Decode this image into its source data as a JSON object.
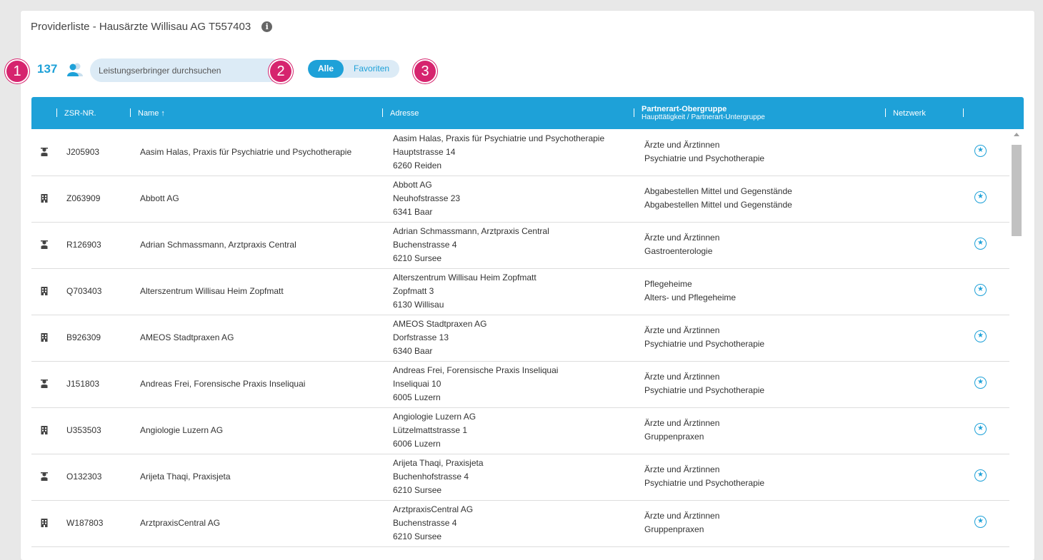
{
  "header": {
    "title": "Providerliste - Hausärzte Willisau AG T557403",
    "info_icon": "i"
  },
  "toolbar": {
    "count": "137",
    "search_placeholder": "Leistungserbringer durchsuchen",
    "filter_all": "Alle",
    "filter_favorites": "Favoriten",
    "active_filter": "Alle"
  },
  "markers": [
    "1",
    "2",
    "3"
  ],
  "table": {
    "headers": {
      "zsr": "ZSR-NR.",
      "name": "Name ↑",
      "address": "Adresse",
      "partner_main": "Partnerart-Obergruppe",
      "partner_sub": "Haupttätigkeit / Partnerart-Untergruppe",
      "network": "Netzwerk"
    },
    "rows": [
      {
        "type": "person",
        "zsr": "J205903",
        "name": "Aasim Halas, Praxis für Psychiatrie und Psychotherapie",
        "addr1": "Aasim Halas, Praxis für Psychiatrie und Psychotherapie",
        "addr2": "Hauptstrasse 14",
        "addr3": "6260 Reiden",
        "part1": "Ärzte und Ärztinnen",
        "part2": "Psychiatrie und Psychotherapie"
      },
      {
        "type": "building",
        "zsr": "Z063909",
        "name": "Abbott AG",
        "addr1": "Abbott AG",
        "addr2": "Neuhofstrasse 23",
        "addr3": "6341 Baar",
        "part1": "Abgabestellen Mittel und Gegenstände",
        "part2": "Abgabestellen Mittel und Gegenstände"
      },
      {
        "type": "person",
        "zsr": "R126903",
        "name": "Adrian Schmassmann, Arztpraxis Central",
        "addr1": "Adrian Schmassmann, Arztpraxis Central",
        "addr2": "Buchenstrasse 4",
        "addr3": "6210 Sursee",
        "part1": "Ärzte und Ärztinnen",
        "part2": "Gastroenterologie"
      },
      {
        "type": "building",
        "zsr": "Q703403",
        "name": "Alterszentrum Willisau Heim Zopfmatt",
        "addr1": "Alterszentrum Willisau Heim Zopfmatt",
        "addr2": "Zopfmatt 3",
        "addr3": "6130 Willisau",
        "part1": "Pflegeheime",
        "part2": "Alters- und Pflegeheime"
      },
      {
        "type": "building",
        "zsr": "B926309",
        "name": "AMEOS Stadtpraxen AG",
        "addr1": "AMEOS Stadtpraxen AG",
        "addr2": "Dorfstrasse 13",
        "addr3": "6340 Baar",
        "part1": "Ärzte und Ärztinnen",
        "part2": "Psychiatrie und Psychotherapie"
      },
      {
        "type": "person",
        "zsr": "J151803",
        "name": "Andreas Frei, Forensische Praxis Inseliquai",
        "addr1": "Andreas Frei, Forensische Praxis Inseliquai",
        "addr2": "Inseliquai 10",
        "addr3": "6005 Luzern",
        "part1": "Ärzte und Ärztinnen",
        "part2": "Psychiatrie und Psychotherapie"
      },
      {
        "type": "building",
        "zsr": "U353503",
        "name": "Angiologie Luzern AG",
        "addr1": "Angiologie Luzern AG",
        "addr2": "Lützelmattstrasse 1",
        "addr3": "6006 Luzern",
        "part1": "Ärzte und Ärztinnen",
        "part2": "Gruppenpraxen"
      },
      {
        "type": "person",
        "zsr": "O132303",
        "name": "Arijeta Thaqi, Praxisjeta",
        "addr1": "Arijeta Thaqi, Praxisjeta",
        "addr2": "Buchenhofstrasse 4",
        "addr3": "6210 Sursee",
        "part1": "Ärzte und Ärztinnen",
        "part2": "Psychiatrie und Psychotherapie"
      },
      {
        "type": "building",
        "zsr": "W187803",
        "name": "ArztpraxisCentral AG",
        "addr1": "ArztpraxisCentral AG",
        "addr2": "Buchenstrasse 4",
        "addr3": "6210 Sursee",
        "part1": "Ärzte und Ärztinnen",
        "part2": "Gruppenpraxen"
      }
    ]
  },
  "colors": {
    "accent": "#1ea1d8",
    "marker": "#d6246e"
  }
}
